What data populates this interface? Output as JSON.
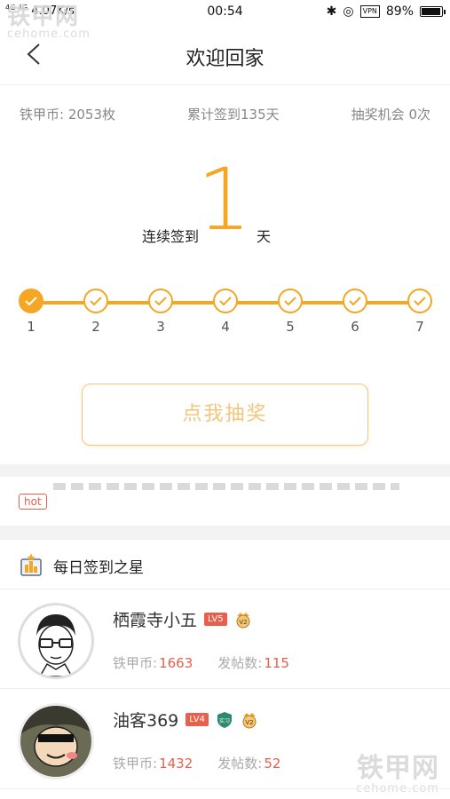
{
  "status_bar": {
    "signal": "4G 4G",
    "speed": "4.07K/s",
    "time": "00:54",
    "vpn": "VPN",
    "battery_pct": "89%",
    "battery_level": 0.89
  },
  "watermark": {
    "cn": "铁甲网",
    "en": "cehome.com"
  },
  "nav": {
    "title": "欢迎回家"
  },
  "stats": {
    "coins": "铁甲币: 2053枚",
    "total_signin": "累计签到135天",
    "lottery_chances": "抽奖机会 0次"
  },
  "streak": {
    "prefix": "连续签到",
    "days": "1",
    "suffix": "天"
  },
  "progress": {
    "days": [
      "1",
      "2",
      "3",
      "4",
      "5",
      "6",
      "7"
    ],
    "completed": 1
  },
  "lottery_button": "点我抽奖",
  "ticker": {
    "hot_tag": "hot"
  },
  "daily_stars": {
    "title": "每日签到之星",
    "users": [
      {
        "name": "栖霞寺小五",
        "level": "LV5",
        "coins_label": "铁甲币:",
        "coins": "1663",
        "posts_label": "发帖数:",
        "posts": "115",
        "extra_badge": ""
      },
      {
        "name": "油客369",
        "level": "LV4",
        "coins_label": "铁甲币:",
        "coins": "1432",
        "posts_label": "发帖数:",
        "posts": "52",
        "extra_badge": "实习"
      }
    ]
  },
  "colors": {
    "accent": "#f5a623",
    "red": "#e8604c"
  }
}
